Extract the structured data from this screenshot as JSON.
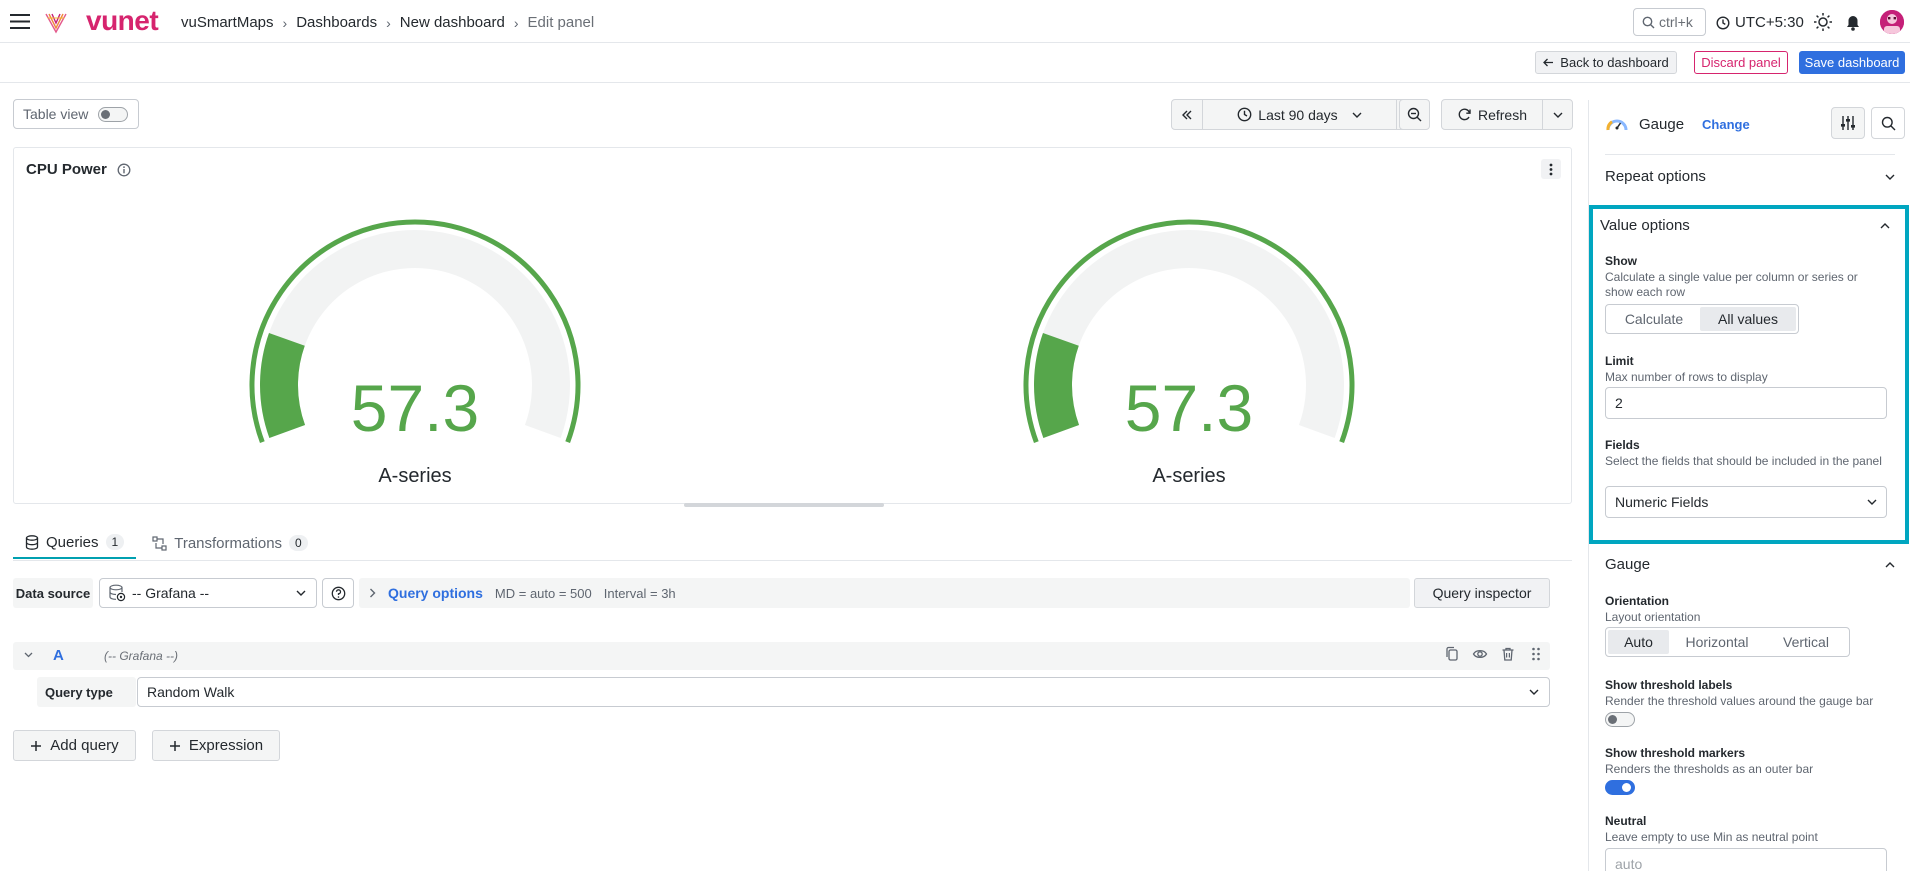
{
  "brand": {
    "name": "vunet"
  },
  "breadcrumb": [
    "vuSmartMaps",
    "Dashboards",
    "New dashboard",
    "Edit panel"
  ],
  "search": {
    "shortcut": "ctrl+k"
  },
  "timezone": "UTC+5:30",
  "actions": {
    "back": "Back to dashboard",
    "discard": "Discard panel",
    "save": "Save dashboard"
  },
  "toolbar": {
    "table_view": "Table view",
    "time_range": "Last 90 days",
    "refresh": "Refresh"
  },
  "panel": {
    "title": "CPU Power",
    "gauges": [
      {
        "value": "57.3",
        "label": "A-series",
        "fraction": 0.18
      },
      {
        "value": "57.3",
        "label": "A-series",
        "fraction": 0.18
      }
    ]
  },
  "query_tabs": [
    {
      "label": "Queries",
      "count": "1"
    },
    {
      "label": "Transformations",
      "count": "0"
    }
  ],
  "datasource": {
    "label": "Data source",
    "value": "-- Grafana --",
    "query_options": "Query options",
    "md": "MD = auto = 500",
    "interval": "Interval = 3h",
    "inspector": "Query inspector"
  },
  "query": {
    "letter": "A",
    "datasource_hint": "(-- Grafana --)",
    "type_label": "Query type",
    "type_value": "Random Walk"
  },
  "add_buttons": {
    "query": "Add query",
    "expression": "Expression"
  },
  "options": {
    "visualization": "Gauge",
    "change": "Change",
    "repeat_options": "Repeat options",
    "value_options": {
      "title": "Value options",
      "show_title": "Show",
      "show_desc": "Calculate a single value per column or series or show each row",
      "show_choices": [
        "Calculate",
        "All values"
      ],
      "show_selected": "All values",
      "limit_title": "Limit",
      "limit_desc": "Max number of rows to display",
      "limit_value": "2",
      "fields_title": "Fields",
      "fields_desc": "Select the fields that should be included in the panel",
      "fields_value": "Numeric Fields"
    },
    "gauge": {
      "title": "Gauge",
      "orientation_title": "Orientation",
      "orientation_desc": "Layout orientation",
      "orientation_choices": [
        "Auto",
        "Horizontal",
        "Vertical"
      ],
      "orientation_selected": "Auto",
      "threshold_labels_title": "Show threshold labels",
      "threshold_labels_desc": "Render the threshold values around the gauge bar",
      "threshold_markers_title": "Show threshold markers",
      "threshold_markers_desc": "Renders the thresholds as an outer bar",
      "neutral_title": "Neutral",
      "neutral_desc": "Leave empty to use Min as neutral point",
      "neutral_placeholder": "auto"
    }
  },
  "colors": {
    "brand": "#d6246e",
    "primary": "#2f6fdf",
    "gauge": "#56a64b",
    "highlight": "#00a6c0"
  }
}
